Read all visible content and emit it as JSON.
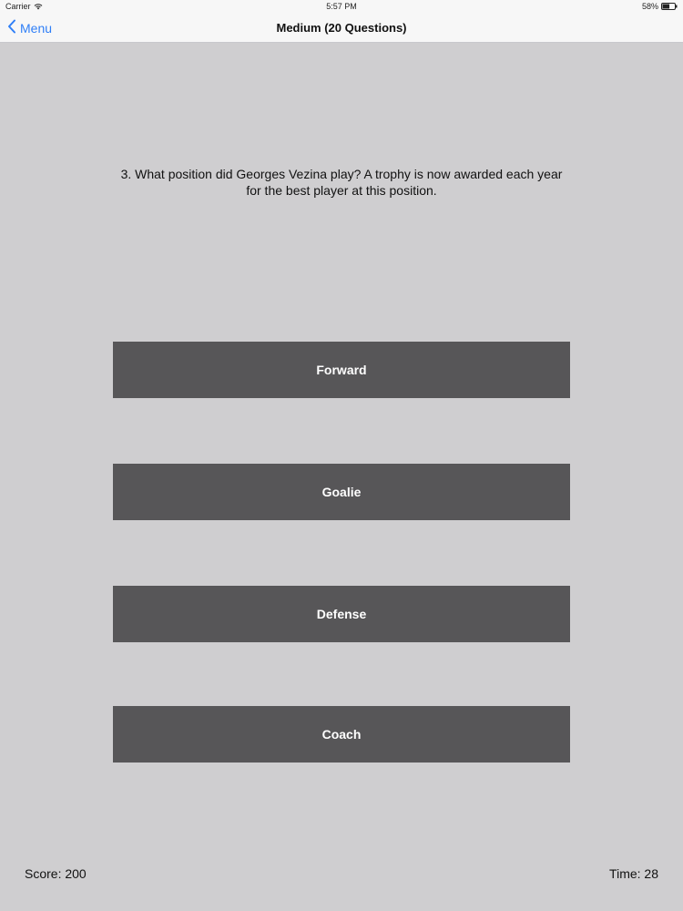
{
  "status_bar": {
    "carrier": "Carrier",
    "time": "5:57 PM",
    "battery": "58%",
    "battery_level": 0.58,
    "icons": [
      "wifi-icon",
      "battery-icon"
    ]
  },
  "nav": {
    "back_label": "Menu",
    "back_icon": "chevron-left-icon",
    "title": "Medium (20 Questions)"
  },
  "question": {
    "text": "3. What position did Georges Vezina play? A trophy is now awarded each year for the best player at this position."
  },
  "answers": [
    {
      "label": "Forward"
    },
    {
      "label": "Goalie"
    },
    {
      "label": "Defense"
    },
    {
      "label": "Coach"
    }
  ],
  "footer": {
    "score": "Score: 200",
    "time": "Time: 28"
  },
  "colors": {
    "background": "#cfced0",
    "answer_bg": "#575658",
    "accent": "#2f7ff7"
  }
}
